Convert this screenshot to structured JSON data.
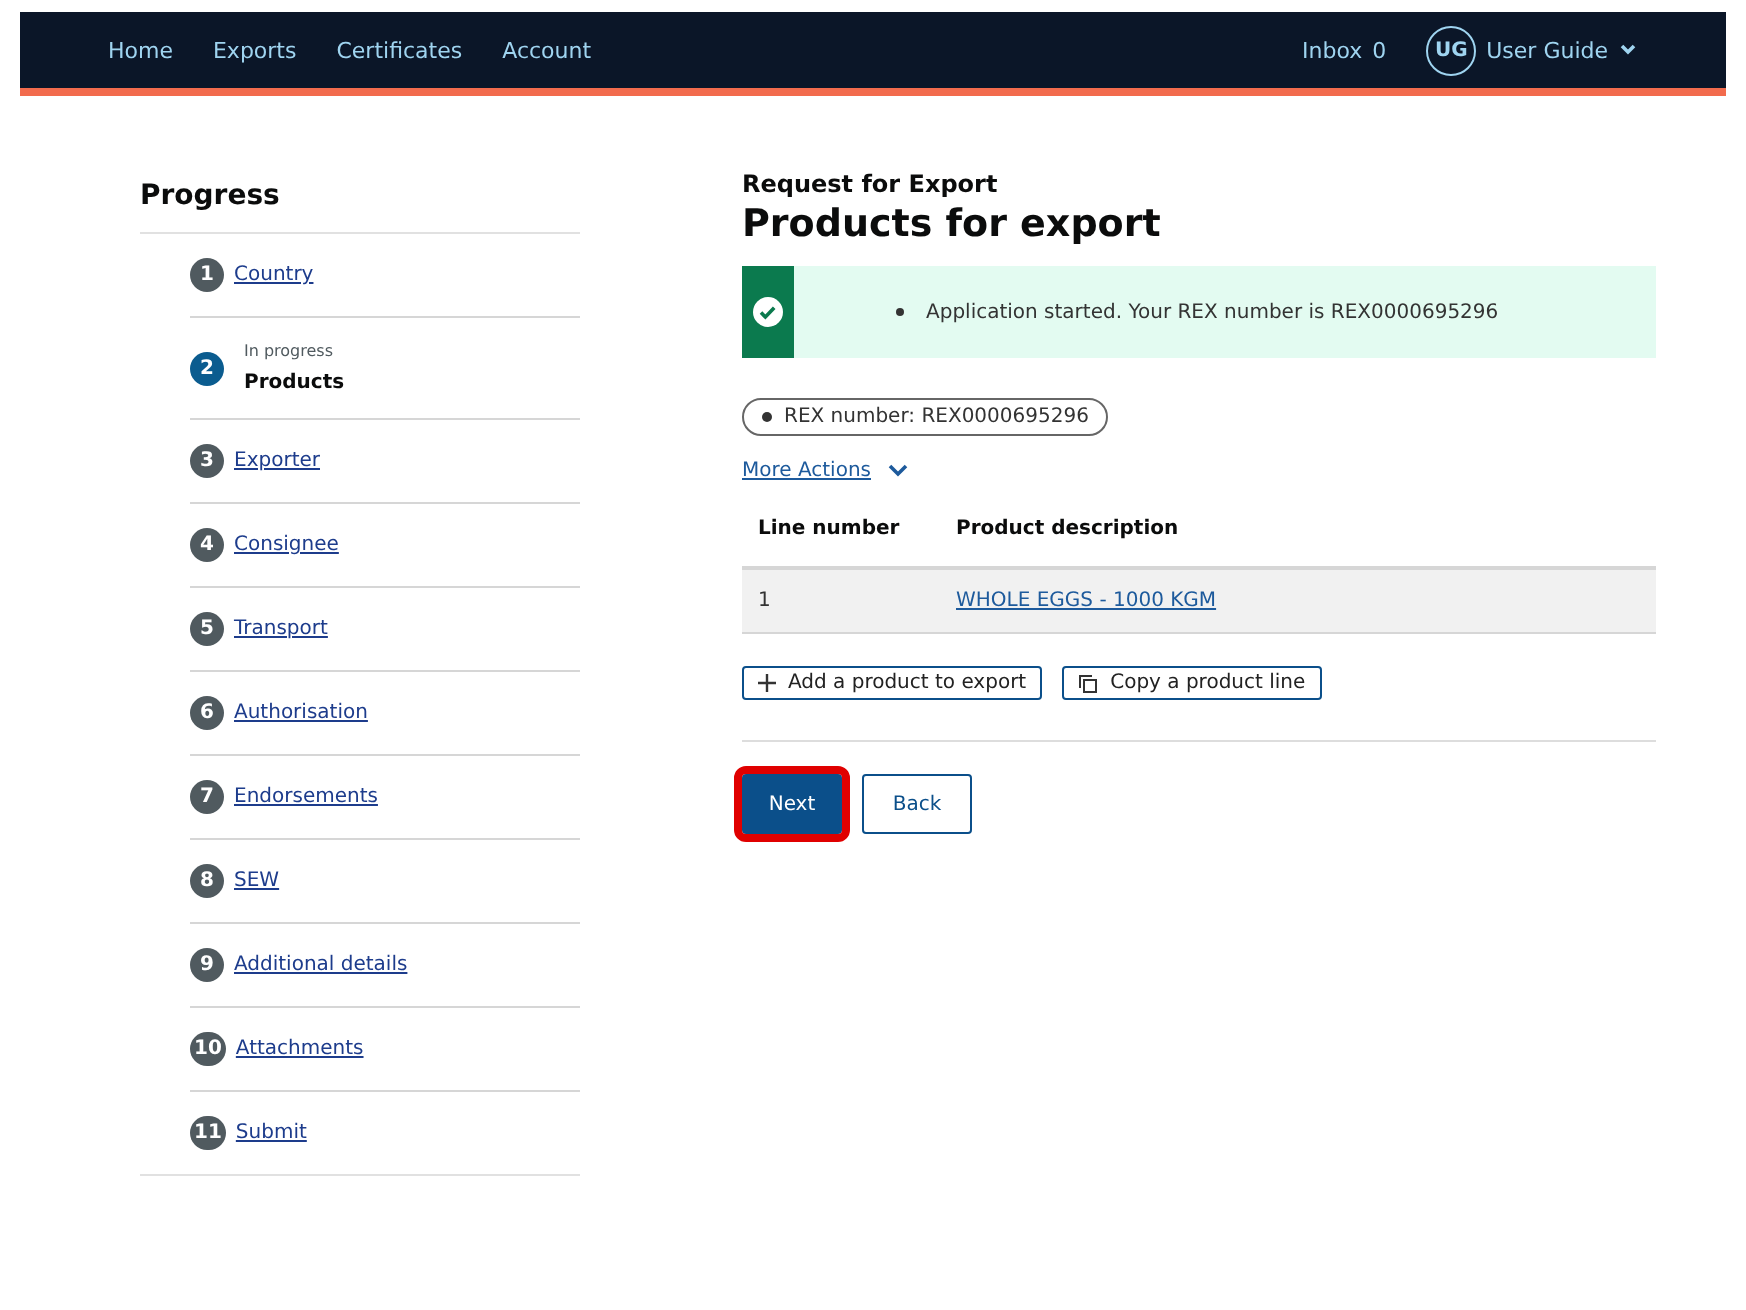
{
  "nav": {
    "links": [
      {
        "label": "Home"
      },
      {
        "label": "Exports"
      },
      {
        "label": "Certificates"
      },
      {
        "label": "Account"
      }
    ],
    "inbox_label": "Inbox",
    "inbox_count": "0",
    "user": {
      "initials": "UG",
      "name": "User Guide"
    }
  },
  "progress": {
    "title": "Progress",
    "steps": [
      {
        "number": "1",
        "label": "Country",
        "current": false
      },
      {
        "number": "2",
        "label": "Products",
        "current": true,
        "status": "In progress"
      },
      {
        "number": "3",
        "label": "Exporter",
        "current": false
      },
      {
        "number": "4",
        "label": "Consignee",
        "current": false
      },
      {
        "number": "5",
        "label": "Transport",
        "current": false
      },
      {
        "number": "6",
        "label": "Authorisation",
        "current": false
      },
      {
        "number": "7",
        "label": "Endorsements",
        "current": false
      },
      {
        "number": "8",
        "label": "SEW",
        "current": false
      },
      {
        "number": "9",
        "label": "Additional details",
        "current": false
      },
      {
        "number": "10",
        "label": "Attachments",
        "current": false
      },
      {
        "number": "11",
        "label": "Submit",
        "current": false
      }
    ]
  },
  "main": {
    "caption": "Request for Export",
    "heading": "Products for export",
    "alert": {
      "kind": "success",
      "message": "Application started. Your REX number is REX0000695296"
    },
    "tag": "REX number: REX0000695296",
    "more_actions": "More Actions",
    "table": {
      "columns": [
        "Line number",
        "Product description"
      ],
      "rows": [
        {
          "line": "1",
          "product": "WHOLE EGGS - 1000 KGM"
        }
      ]
    },
    "actions": [
      {
        "kind": "add",
        "label": "Add a product to export"
      },
      {
        "kind": "copy",
        "label": "Copy a product line"
      }
    ],
    "buttons": [
      {
        "kind": "primary",
        "label": "Next",
        "highlighted": true
      },
      {
        "kind": "secondary",
        "label": "Back",
        "highlighted": false
      }
    ]
  }
}
